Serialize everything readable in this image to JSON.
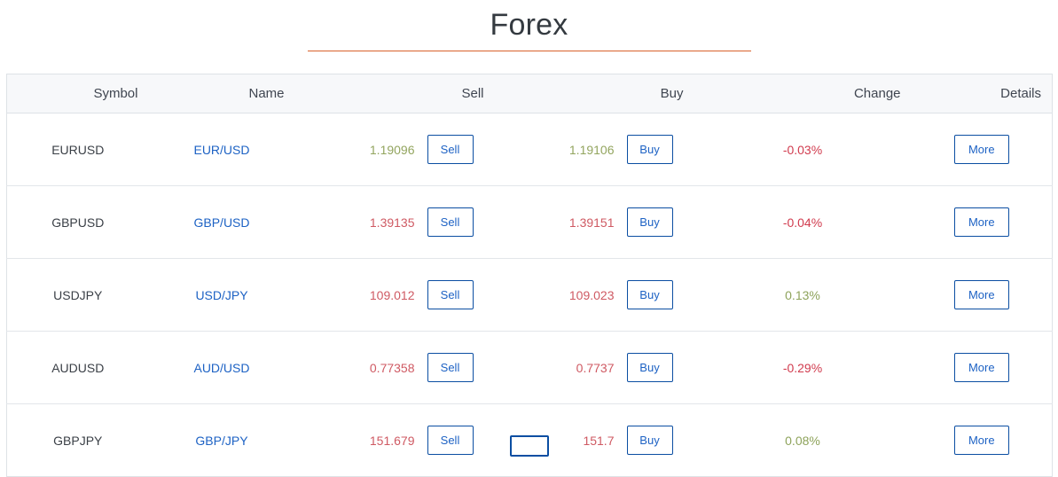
{
  "header": {
    "title": "Forex",
    "rule_color": "#d9622b"
  },
  "table": {
    "columns": [
      {
        "key": "symbol",
        "label": "Symbol"
      },
      {
        "key": "name",
        "label": "Name"
      },
      {
        "key": "sell",
        "label": "Sell"
      },
      {
        "key": "buy",
        "label": "Buy"
      },
      {
        "key": "change",
        "label": "Change"
      },
      {
        "key": "details",
        "label": "Details"
      }
    ],
    "sell_button_label": "Sell",
    "buy_button_label": "Buy",
    "details_button_label": "More",
    "rows": [
      {
        "symbol": "EURUSD",
        "name": "EUR/USD",
        "sell": "1.19096",
        "sell_dir": "up",
        "buy": "1.19106",
        "buy_dir": "up",
        "change": "-0.03%",
        "change_dir": "down"
      },
      {
        "symbol": "GBPUSD",
        "name": "GBP/USD",
        "sell": "1.39135",
        "sell_dir": "down",
        "buy": "1.39151",
        "buy_dir": "down",
        "change": "-0.04%",
        "change_dir": "down"
      },
      {
        "symbol": "USDJPY",
        "name": "USD/JPY",
        "sell": "109.012",
        "sell_dir": "down",
        "buy": "109.023",
        "buy_dir": "down",
        "change": "0.13%",
        "change_dir": "up"
      },
      {
        "symbol": "AUDUSD",
        "name": "AUD/USD",
        "sell": "0.77358",
        "sell_dir": "down",
        "buy": "0.7737",
        "buy_dir": "down",
        "change": "-0.29%",
        "change_dir": "down"
      },
      {
        "symbol": "GBPJPY",
        "name": "GBP/JPY",
        "sell": "151.679",
        "sell_dir": "down",
        "buy": "151.7",
        "buy_dir": "down",
        "change": "0.08%",
        "change_dir": "up"
      }
    ]
  },
  "footer": {
    "action_label": ""
  },
  "colors": {
    "accent_orange": "#d9622b",
    "link_blue": "#1d62c4",
    "border_blue": "#0b4ea2",
    "positive_green": "#8ea35b",
    "negative_red": "#d13b4e",
    "header_bg": "#f7f8fa",
    "border_gray": "#dee2e6"
  }
}
